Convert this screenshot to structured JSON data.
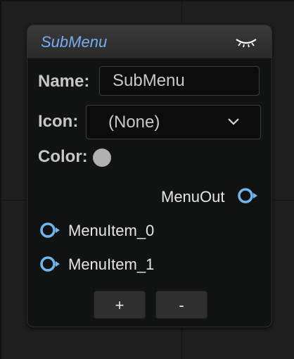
{
  "node": {
    "title": "SubMenu",
    "name_label": "Name:",
    "name_value": "SubMenu",
    "icon_label": "Icon:",
    "icon_value": "(None)",
    "color_label": "Color:",
    "color_value": "#b0b0b0",
    "output_pin": "MenuOut",
    "input_pins": [
      "MenuItem_0",
      "MenuItem_1"
    ],
    "add_label": "+",
    "remove_label": "-"
  },
  "colors": {
    "title": "#74aef0",
    "pin": "#6fb7ee",
    "background": "#1e1e1e"
  },
  "icons": {
    "collapse": "eye-closed-icon",
    "dropdown": "chevron-down-icon",
    "pin": "exec-pin-icon"
  }
}
